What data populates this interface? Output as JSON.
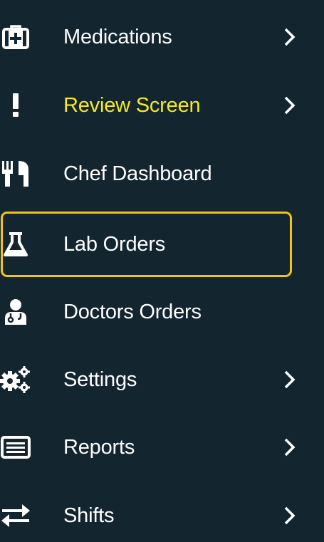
{
  "sidebar": {
    "items": [
      {
        "label": "Medications",
        "icon": "medkit-icon",
        "has_submenu": true
      },
      {
        "label": "Review Screen",
        "icon": "exclamation-icon",
        "has_submenu": true,
        "highlighted": true
      },
      {
        "label": "Chef Dashboard",
        "icon": "utensils-icon",
        "has_submenu": false
      },
      {
        "label": "Lab Orders",
        "icon": "flask-icon",
        "has_submenu": false,
        "selected": true
      },
      {
        "label": "Doctors Orders",
        "icon": "user-doctor-icon",
        "has_submenu": false
      },
      {
        "label": "Settings",
        "icon": "cogs-icon",
        "has_submenu": true
      },
      {
        "label": "Reports",
        "icon": "list-alt-icon",
        "has_submenu": true
      },
      {
        "label": "Shifts",
        "icon": "exchange-icon",
        "has_submenu": true
      }
    ]
  },
  "colors": {
    "background": "#13252f",
    "text": "#ffffff",
    "highlight_text": "#f6ea22",
    "selected_border": "#f2c318"
  }
}
